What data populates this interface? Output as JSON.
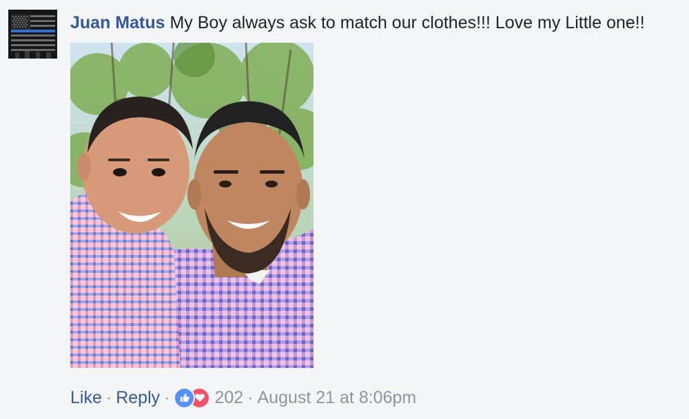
{
  "comment": {
    "author": "Juan Matus",
    "text": "My Boy always ask to match our clothes!!! Love my Little one!!",
    "avatar_icon": "thin-blue-line-flag",
    "photo_description_icon": "comment-photo"
  },
  "actions": {
    "like_label": "Like",
    "reply_label": "Reply",
    "separator": "·",
    "reaction_count": "202",
    "timestamp": "August 21 at 8:06pm",
    "reaction_icons": [
      "like-icon",
      "love-icon"
    ]
  },
  "colors": {
    "link": "#365899",
    "meta": "#90949c",
    "text": "#1d2129",
    "like": "#5890ff",
    "love": "#f25268",
    "background": "#f4f5f7"
  }
}
